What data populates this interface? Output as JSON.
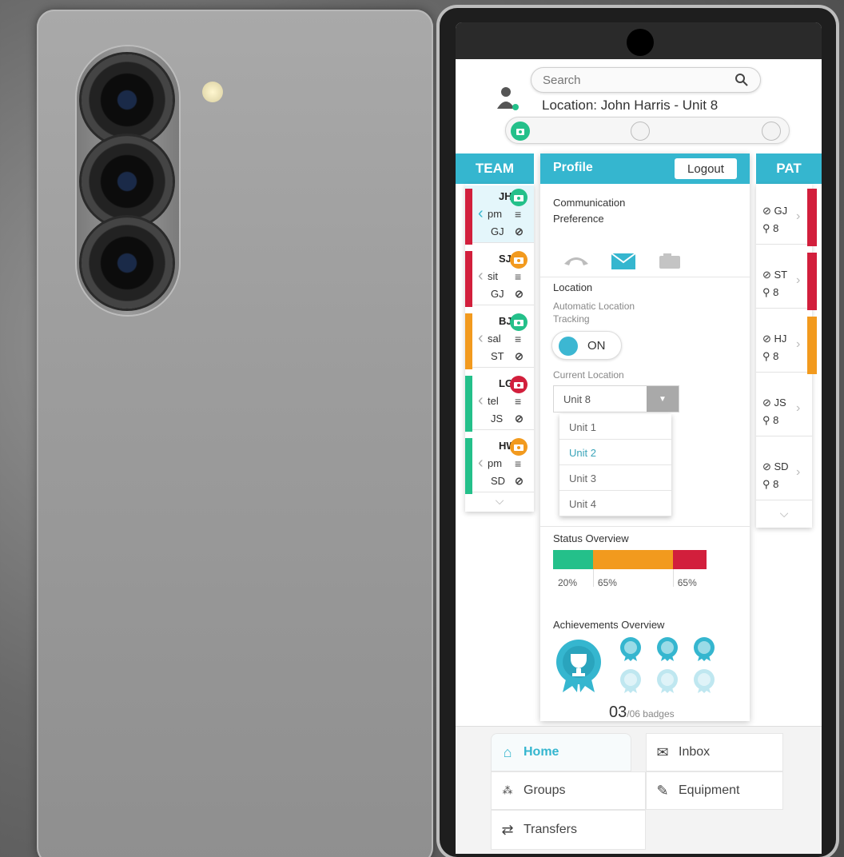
{
  "search": {
    "placeholder": "Search"
  },
  "header": {
    "location": "Location: John Harris - Unit 8"
  },
  "team": {
    "title": "TEAM",
    "members": [
      {
        "initials": "JH",
        "role": "pm",
        "patient": "GJ",
        "status_color": "#d21f3c",
        "cam_color": "#24c08a",
        "active": true
      },
      {
        "initials": "SJ",
        "role": "sit",
        "patient": "GJ",
        "status_color": "#d21f3c",
        "cam_color": "#f29a1e",
        "active": false
      },
      {
        "initials": "BJ",
        "role": "sal",
        "patient": "ST",
        "status_color": "#f29a1e",
        "cam_color": "#24c08a",
        "active": false
      },
      {
        "initials": "LG",
        "role": "tel",
        "patient": "JS",
        "status_color": "#24c08a",
        "cam_color": "#d21f3c",
        "active": false
      },
      {
        "initials": "HW",
        "role": "pm",
        "patient": "SD",
        "status_color": "#24c08a",
        "cam_color": "#f29a1e",
        "active": false
      }
    ]
  },
  "patients": {
    "title": "PAT",
    "items": [
      {
        "initials": "GJ",
        "unit": "8",
        "status_color": "#d21f3c"
      },
      {
        "initials": "ST",
        "unit": "8",
        "status_color": "#d21f3c"
      },
      {
        "initials": "HJ",
        "unit": "8",
        "status_color": "#f29a1e"
      },
      {
        "initials": "JS",
        "unit": "8",
        "status_color": ""
      },
      {
        "initials": "SD",
        "unit": "8",
        "status_color": ""
      }
    ]
  },
  "profile": {
    "title": "Profile",
    "logout": "Logout",
    "comm_label_1": "Communication",
    "comm_label_2": "Preference",
    "location_label": "Location",
    "auto_tracking_1": "Automatic Location",
    "auto_tracking_2": "Tracking",
    "toggle_state": "ON",
    "current_location_label": "Current Location",
    "current_location_value": "Unit 8",
    "location_options": [
      "Unit 1",
      "Unit 2",
      "Unit 3",
      "Unit 4"
    ],
    "selected_option_index": 1,
    "status_label": "Status Overview",
    "status_segments": [
      {
        "pct_label": "20%",
        "color": "#24c08a",
        "share": 0.26
      },
      {
        "pct_label": "65%",
        "color": "#f29a1e",
        "share": 0.52
      },
      {
        "pct_label": "65%",
        "color": "#d21f3c",
        "share": 0.22
      }
    ],
    "achievements_label": "Achievements Overview",
    "badges_count": "03",
    "badges_total": "/06 badges"
  },
  "nav": {
    "home": "Home",
    "inbox": "Inbox",
    "groups": "Groups",
    "equipment": "Equipment",
    "transfers": "Transfers"
  },
  "colors": {
    "accent": "#35b6cf",
    "green": "#24c08a",
    "orange": "#f29a1e",
    "red": "#d21f3c"
  }
}
